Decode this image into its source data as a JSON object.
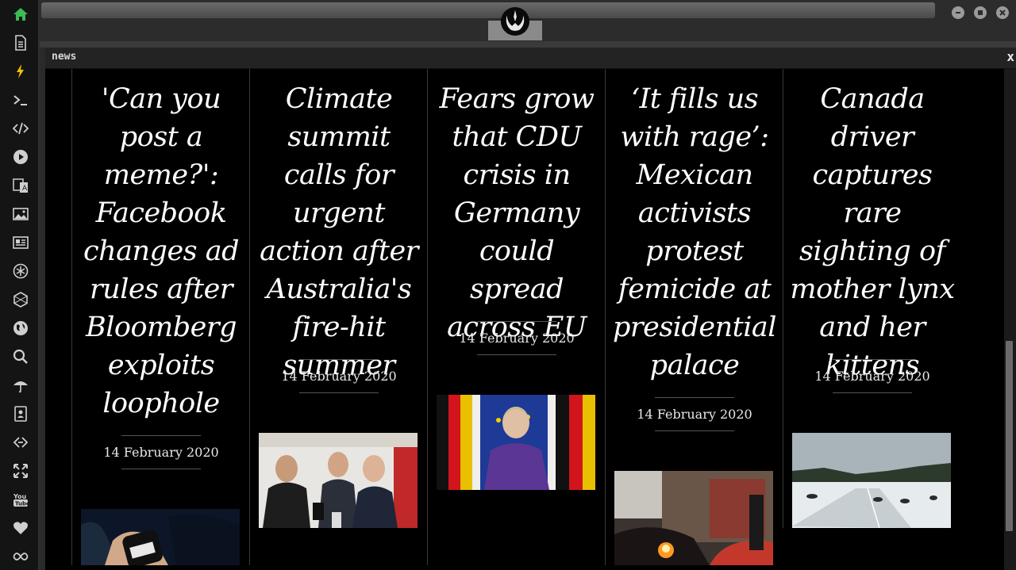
{
  "window": {
    "title": "news",
    "close_label": "x"
  },
  "sidebar": {
    "items": [
      {
        "icon": "home-icon"
      },
      {
        "icon": "document-icon"
      },
      {
        "icon": "lightning-icon"
      },
      {
        "icon": "terminal-icon"
      },
      {
        "icon": "code-icon"
      },
      {
        "icon": "play-icon"
      },
      {
        "icon": "translate-icon"
      },
      {
        "icon": "image-icon"
      },
      {
        "icon": "news-icon"
      },
      {
        "icon": "asterisk-icon"
      },
      {
        "icon": "hexagon-icon"
      },
      {
        "icon": "globe-icon"
      },
      {
        "icon": "search-icon"
      },
      {
        "icon": "umbrella-icon"
      },
      {
        "icon": "contacts-icon"
      },
      {
        "icon": "link-icon"
      },
      {
        "icon": "expand-icon"
      },
      {
        "icon": "youtube-icon"
      },
      {
        "icon": "heart-icon"
      },
      {
        "icon": "infinity-icon"
      }
    ]
  },
  "articles": [
    {
      "headline": "'Can you post a meme?': Facebook changes ad rules after Bloomberg exploits loophole",
      "date": "14 February 2020"
    },
    {
      "headline": "Climate summit calls for urgent action after Australia's fire-hit summer",
      "date": "14 February 2020"
    },
    {
      "headline": "Fears grow that CDU crisis in Germany could spread across EU",
      "date": "14 February 2020"
    },
    {
      "headline": "‘It fills us with rage’: Mexican activists protest femicide at presidential palace",
      "date": "14 February 2020"
    },
    {
      "headline": "Canada driver captures rare sighting of mother lynx and her kittens",
      "date": "14 February 2020"
    }
  ],
  "colors": {
    "accent_home": "#3cba54",
    "accent_bolt": "#f2c200"
  }
}
